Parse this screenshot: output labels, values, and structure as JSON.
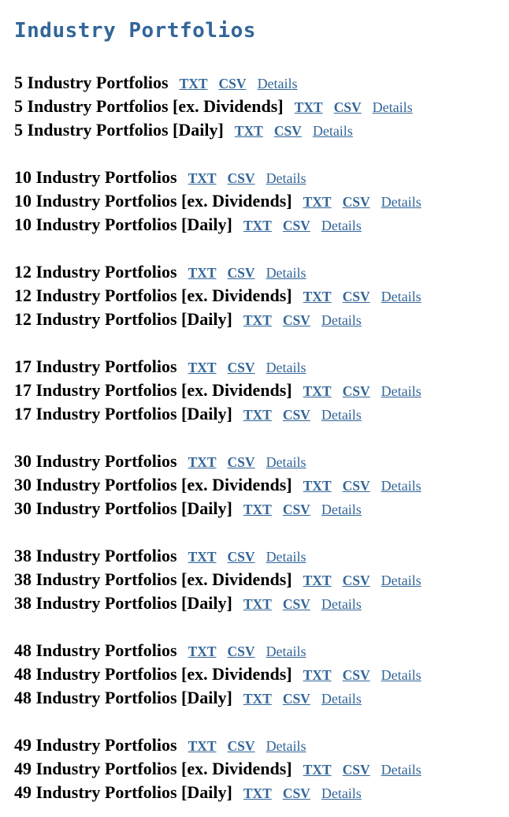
{
  "page": {
    "title": "Industry Portfolios"
  },
  "link_labels": {
    "txt": "TXT",
    "csv": "CSV",
    "details": "Details"
  },
  "groups": [
    {
      "rows": [
        {
          "name": "5 Industry Portfolios"
        },
        {
          "name": "5 Industry Portfolios [ex. Dividends]"
        },
        {
          "name": "5 Industry Portfolios [Daily]"
        }
      ]
    },
    {
      "rows": [
        {
          "name": "10 Industry Portfolios"
        },
        {
          "name": "10 Industry Portfolios [ex. Dividends]"
        },
        {
          "name": "10 Industry Portfolios [Daily]"
        }
      ]
    },
    {
      "rows": [
        {
          "name": "12 Industry Portfolios"
        },
        {
          "name": "12 Industry Portfolios [ex. Dividends]"
        },
        {
          "name": "12 Industry Portfolios [Daily]"
        }
      ]
    },
    {
      "rows": [
        {
          "name": "17 Industry Portfolios"
        },
        {
          "name": "17 Industry Portfolios [ex. Dividends]"
        },
        {
          "name": "17 Industry Portfolios [Daily]"
        }
      ]
    },
    {
      "rows": [
        {
          "name": "30 Industry Portfolios"
        },
        {
          "name": "30 Industry Portfolios [ex. Dividends]"
        },
        {
          "name": "30 Industry Portfolios [Daily]"
        }
      ]
    },
    {
      "rows": [
        {
          "name": "38 Industry Portfolios"
        },
        {
          "name": "38 Industry Portfolios [ex. Dividends]"
        },
        {
          "name": "38 Industry Portfolios [Daily]"
        }
      ]
    },
    {
      "rows": [
        {
          "name": "48 Industry Portfolios"
        },
        {
          "name": "48 Industry Portfolios [ex. Dividends]"
        },
        {
          "name": "48 Industry Portfolios [Daily]"
        }
      ]
    },
    {
      "rows": [
        {
          "name": "49 Industry Portfolios"
        },
        {
          "name": "49 Industry Portfolios [ex. Dividends]"
        },
        {
          "name": "49 Industry Portfolios [Daily]"
        }
      ]
    }
  ],
  "colors": {
    "link": "#336699",
    "title": "#336699",
    "text": "#000000",
    "background": "#ffffff"
  }
}
